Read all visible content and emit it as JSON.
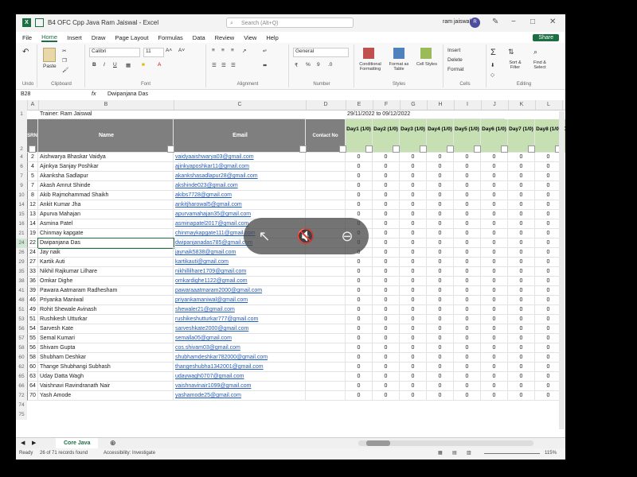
{
  "window": {
    "title": "B4 OFC Cpp Java Ram Jaiswal - Excel",
    "search_placeholder": "Search (Alt+Q)",
    "user_name": "ram jaiswal",
    "avatar_initials": "R"
  },
  "menu": [
    "File",
    "Home",
    "Insert",
    "Draw",
    "Page Layout",
    "Formulas",
    "Data",
    "Review",
    "View",
    "Help"
  ],
  "share_label": "Share",
  "ribbon": {
    "clipboard": {
      "paste": "Paste",
      "label": "Clipboard"
    },
    "font": {
      "name": "Calibri",
      "size": "11",
      "label": "Font"
    },
    "alignment": {
      "label": "Alignment"
    },
    "number": {
      "format": "General",
      "label": "Number"
    },
    "styles": {
      "cond": "Conditional Formatting",
      "table": "Format as Table",
      "cell": "Cell Styles",
      "label": "Styles"
    },
    "cells": {
      "insert": "Insert",
      "delete": "Delete",
      "format": "Format",
      "label": "Cells"
    },
    "editing": {
      "sort": "Sort & Filter",
      "find": "Find & Select",
      "label": "Editing"
    },
    "undo_label": "Undo"
  },
  "formula_bar": {
    "name_box": "B28",
    "fx": "fx",
    "value": "Dwipanjana Das"
  },
  "columns": [
    "A",
    "B",
    "C",
    "D",
    "E",
    "F",
    "G",
    "H",
    "I",
    "J",
    "K",
    "L"
  ],
  "sheet": {
    "trainer": "Trainer: Ram Jaiswal",
    "date_range": "29/11/2022 to 09/12/2022",
    "headers": {
      "srn": "SRN",
      "name": "Name",
      "email": "Email",
      "contact": "Contact No"
    },
    "days": [
      "Day1 (1/0)",
      "Day2 (1/0)",
      "Day3 (1/0)",
      "Day4 (1/0)",
      "Day5 (1/0)",
      "Day6 (1/0)",
      "Day7 (1/0)",
      "Day8 (1/0)",
      "Da (1"
    ],
    "rows": [
      {
        "r": "4",
        "srn": "2",
        "name": "Aishwarya Bhaskar Vaidya",
        "email": "vaidyaaishwarya03@gmail.com"
      },
      {
        "r": "6",
        "srn": "4",
        "name": "Ajinkya Sanjay Poshkar",
        "email": "ajinkyaposhkar11@gmail.com"
      },
      {
        "r": "7",
        "srn": "5",
        "name": "Akanksha Sadlapur",
        "email": "akankshasadlapur28@gmail.com"
      },
      {
        "r": "9",
        "srn": "7",
        "name": "Akash Amrut Shinde",
        "email": "akshinde023@gmail.com"
      },
      {
        "r": "10",
        "srn": "8",
        "name": "Akib Rajmohammad Shaikh",
        "email": "akibs7728@gmail.com"
      },
      {
        "r": "14",
        "srn": "12",
        "name": "Ankit Kumar Jha",
        "email": "ankitjharowal5@gmail.com"
      },
      {
        "r": "15",
        "srn": "13",
        "name": "Apurva Mahajan",
        "email": "apurvamahajan35@gmail.com"
      },
      {
        "r": "16",
        "srn": "14",
        "name": "Asmina Patel",
        "email": "asminapatel2017@gmail.com"
      },
      {
        "r": "21",
        "srn": "19",
        "name": "Chinmay kapgate",
        "email": "chinmaykapgate111@gmail.com"
      },
      {
        "r": "24",
        "srn": "22",
        "name": "Dwipanjana Das",
        "email": "dwipanjanadas785@gmail.com"
      },
      {
        "r": "26",
        "srn": "24",
        "name": "Jay naik",
        "email": "jaynaik5838@gmail.com"
      },
      {
        "r": "29",
        "srn": "27",
        "name": "Kartik Auti",
        "email": "kartikauti@gmail.com"
      },
      {
        "r": "35",
        "srn": "33",
        "name": "Nikhil Rajkumar Lilhare",
        "email": "nikhillilhare1709@gmail.com"
      },
      {
        "r": "38",
        "srn": "36",
        "name": "Omkar Dighe",
        "email": "omkardighe1122@gmail.com"
      },
      {
        "r": "41",
        "srn": "39",
        "name": "Pawara Aatmaram Radhesham",
        "email": "pawaraaatmaram2000@gmail.com"
      },
      {
        "r": "48",
        "srn": "46",
        "name": "Priyanka Maniwal",
        "email": "priyankamaniwal@gmail.com"
      },
      {
        "r": "51",
        "srn": "49",
        "name": "Rohit Shewale Avinash",
        "email": "shewaler21@gmail.com"
      },
      {
        "r": "53",
        "srn": "51",
        "name": "Rushikesh Utturkar",
        "email": "rushikeshutturkar777@gmail.com"
      },
      {
        "r": "56",
        "srn": "54",
        "name": "Sarvesh Kate",
        "email": "sarveshkate2000@gmail.com"
      },
      {
        "r": "57",
        "srn": "55",
        "name": "Semal Kumari",
        "email": "semalla05@gmail.com"
      },
      {
        "r": "58",
        "srn": "56",
        "name": "Shivam Gupta",
        "email": "cos.shivam03@gmail.com"
      },
      {
        "r": "60",
        "srn": "58",
        "name": "Shubham Deshkar",
        "email": "shubhamdeshkar782000@gmail.com"
      },
      {
        "r": "62",
        "srn": "60",
        "name": "Thange Shubhangi Subhash",
        "email": "thangeshubha1342001@gmail.com"
      },
      {
        "r": "65",
        "srn": "63",
        "name": "Uday Datta Wagh",
        "email": "udaywagh0707@gmail.com"
      },
      {
        "r": "66",
        "srn": "64",
        "name": "Vaishnavi Ravindranath Nair",
        "email": "vaishnavinair1099@gmail.com"
      },
      {
        "r": "72",
        "srn": "70",
        "name": "Yash Amode",
        "email": "yashamode25@gmail.com"
      }
    ],
    "zero": "0"
  },
  "row_labels": {
    "r1": "1",
    "r2": "2",
    "r74": "74",
    "r75": "75"
  },
  "sheet_tab": "Core Java",
  "status": {
    "ready": "Ready",
    "found": "26 of 71 records found",
    "accessibility": "Accessibility: Investigate",
    "zoom": "115%"
  }
}
